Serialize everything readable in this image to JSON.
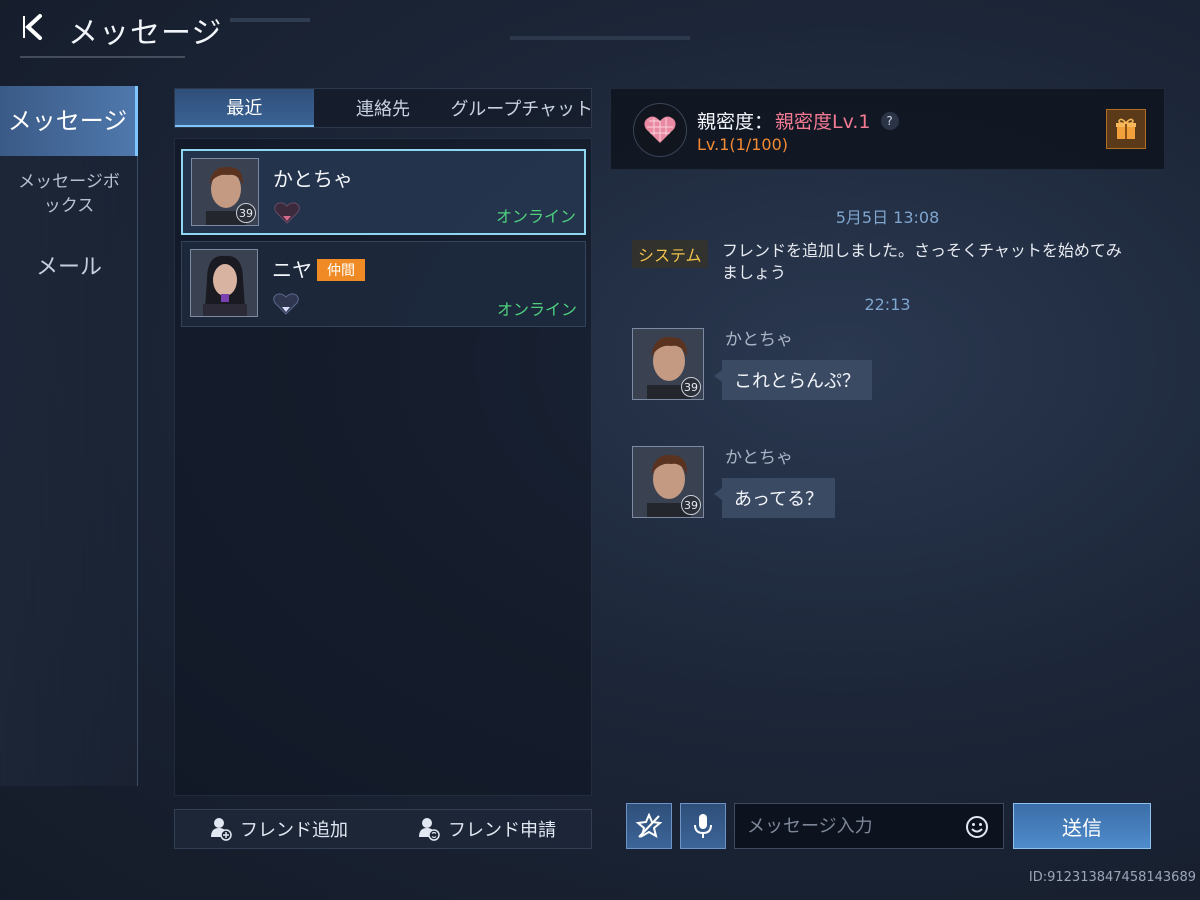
{
  "header": {
    "title": "メッセージ"
  },
  "sidebar": {
    "items": [
      {
        "label": "メッセージ"
      },
      {
        "label": "メッセージボックス"
      },
      {
        "label": "メール"
      }
    ]
  },
  "tabs": [
    {
      "label": "最近"
    },
    {
      "label": "連絡先"
    },
    {
      "label": "グループチャット"
    }
  ],
  "contacts": [
    {
      "name": "かとちゃ",
      "tag": "",
      "status": "オンライン",
      "level": "39"
    },
    {
      "name": "ニヤ",
      "tag": "仲間",
      "status": "オンライン",
      "level": ""
    }
  ],
  "bottom_buttons": {
    "add_friend": "フレンド追加",
    "friend_request": "フレンド申請"
  },
  "chat_header": {
    "intimacy_label": "親密度：",
    "intimacy_level": "親密度Lv.1",
    "help": "?",
    "progress": "Lv.1(1/100)"
  },
  "chat": {
    "date1": "5月5日 13:08",
    "system_tag": "システム",
    "system_text": "フレンドを追加しました。さっそくチャットを始めてみましょう",
    "time2": "22:13",
    "messages": [
      {
        "sender": "かとちゃ",
        "text": "これとらんぷ？",
        "level": "39"
      },
      {
        "sender": "かとちゃ",
        "text": "あってる？",
        "level": "39"
      }
    ]
  },
  "input": {
    "placeholder": "メッセージ入力",
    "send_label": "送信"
  },
  "footer": {
    "user_id": "ID:912313847458143689"
  },
  "colors": {
    "accent": "#4f8bcc",
    "online": "#4fd07e",
    "intimacy": "#f37a93",
    "tag": "#f08a24",
    "system": "#f0c24a"
  }
}
